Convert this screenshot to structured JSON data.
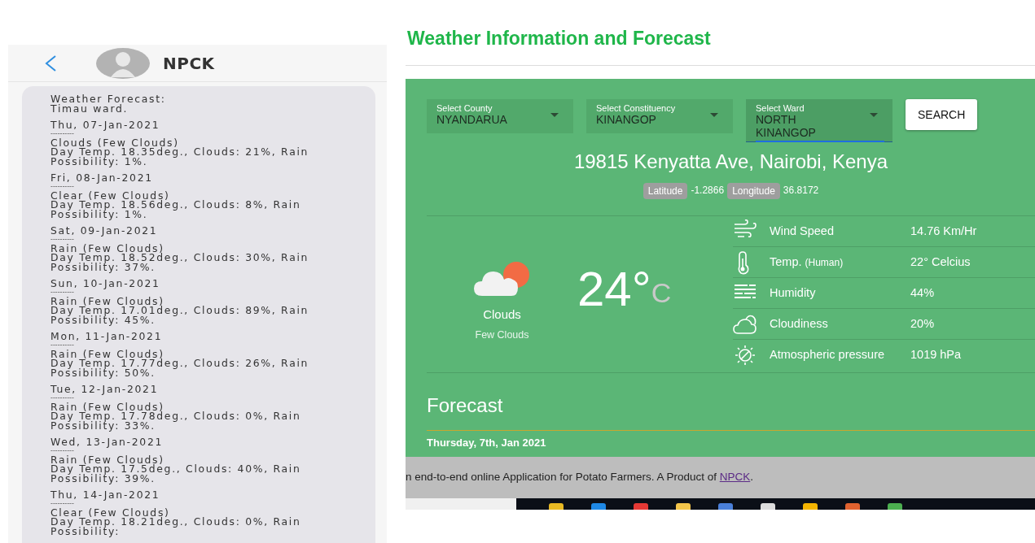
{
  "sms": {
    "contact": "NPCK",
    "intro": [
      "Weather Forecast:",
      "Timau ward."
    ],
    "days": [
      {
        "date": "Thu, 07-Jan-2021",
        "separator": "----------",
        "summary": "Clouds (Few Clouds)",
        "details": "Day Temp. 18.35deg., Clouds: 21%, Rain Possibility: 1%."
      },
      {
        "date": "Fri, 08-Jan-2021",
        "separator": "----------",
        "summary": "Clear (Few Clouds)",
        "details": "Day Temp. 18.56deg., Clouds: 8%, Rain Possibility: 1%."
      },
      {
        "date": "Sat, 09-Jan-2021",
        "separator": "----------",
        "summary": "Rain (Few Clouds)",
        "details": "Day Temp. 18.52deg., Clouds: 30%, Rain Possibility: 37%."
      },
      {
        "date": "Sun, 10-Jan-2021",
        "separator": "----------",
        "summary": "Rain (Few Clouds)",
        "details": "Day Temp. 17.01deg., Clouds: 89%, Rain Possibility: 45%."
      },
      {
        "date": "Mon, 11-Jan-2021",
        "separator": "----------",
        "summary": "Rain (Few Clouds)",
        "details": "Day Temp. 17.77deg., Clouds: 26%, Rain Possibility: 50%."
      },
      {
        "date": "Tue, 12-Jan-2021",
        "separator": "----------",
        "summary": "Rain (Few Clouds)",
        "details": "Day Temp. 17.78deg., Clouds: 0%, Rain Possibility: 33%."
      },
      {
        "date": "Wed, 13-Jan-2021",
        "separator": "----------",
        "summary": "Rain (Few Clouds)",
        "details": "Day Temp. 17.5deg., Clouds: 40%, Rain Possibility: 39%."
      },
      {
        "date": "Thu, 14-Jan-2021",
        "separator": "----------",
        "summary": "Clear (Few Clouds)",
        "details": "Day Temp. 18.21deg., Clouds: 0%, Rain Possibility:"
      }
    ]
  },
  "weather_app": {
    "title": "Weather Information and Forecast",
    "selects": [
      {
        "label": "Select County",
        "value": "NYANDARUA",
        "focused": false
      },
      {
        "label": "Select Constituency",
        "value": "KINANGOP",
        "focused": false
      },
      {
        "label": "Select Ward",
        "value": "NORTH KINANGOP",
        "focused": true
      }
    ],
    "search_button": "SEARCH",
    "address": "19815 Kenyatta Ave, Nairobi, Kenya",
    "coordinates": [
      {
        "label": "Latitude",
        "value": "-1.2866"
      },
      {
        "label": "Longitude",
        "value": "36.8172"
      }
    ],
    "current": {
      "condition": "Clouds",
      "description": "Few Clouds",
      "temperature": "24°",
      "unit": "C"
    },
    "details": [
      {
        "kind": "wind",
        "label": "Wind Speed",
        "value": "14.76 Km/Hr"
      },
      {
        "kind": "thermometer",
        "label": "Temp.",
        "qualifier": "(Human)",
        "value": "22° Celcius"
      },
      {
        "kind": "humidity",
        "label": "Humidity",
        "value": "44%"
      },
      {
        "kind": "cloud",
        "label": "Cloudiness",
        "value": "20%"
      },
      {
        "kind": "sun",
        "label": "Atmospheric pressure",
        "value": "1019 hPa"
      }
    ],
    "forecast": {
      "heading": "Forecast",
      "first_day": "Thursday, 7th, Jan 2021"
    },
    "footer": {
      "text": "n end-to-end online Application for Potato Farmers. A Product of",
      "link": "NPCK",
      "trailing": "."
    }
  }
}
